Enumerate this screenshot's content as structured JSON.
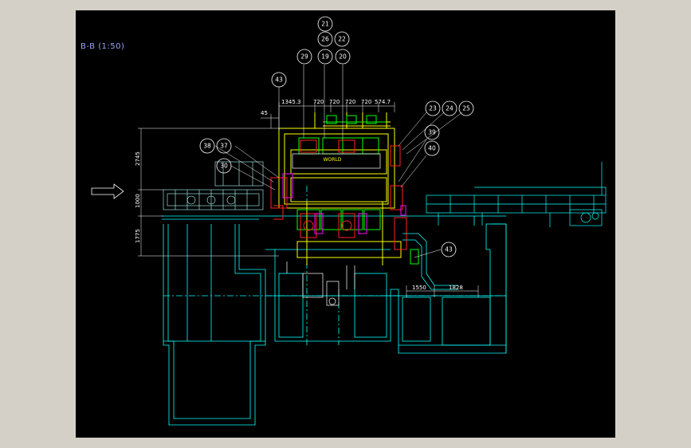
{
  "view_title": "B-B (1:50)",
  "colors": {
    "page_bg": "#d4d0c8",
    "canvas_bg": "#000000",
    "foundation": "#00ffff",
    "frame": "#ffff00",
    "equipment_red": "#ff2020",
    "equipment_green": "#00ff00",
    "equipment_magenta": "#ff00ff",
    "dimension": "#ffffff",
    "title": "#9aa0ff"
  },
  "dimensions_top": [
    "45",
    "1345.3",
    "720",
    "720",
    "720",
    "720",
    "574.7"
  ],
  "dimensions_left": [
    "2745",
    "1000",
    "1775"
  ],
  "dimensions_bottom": [
    "1550",
    "1828"
  ],
  "feed_arrow": "right-arrow",
  "balloons": [
    "21",
    "26",
    "22",
    "29",
    "19",
    "20",
    "43",
    "23",
    "24",
    "25",
    "39",
    "40",
    "38",
    "37",
    "30",
    "43"
  ],
  "block_label": "WORLD"
}
